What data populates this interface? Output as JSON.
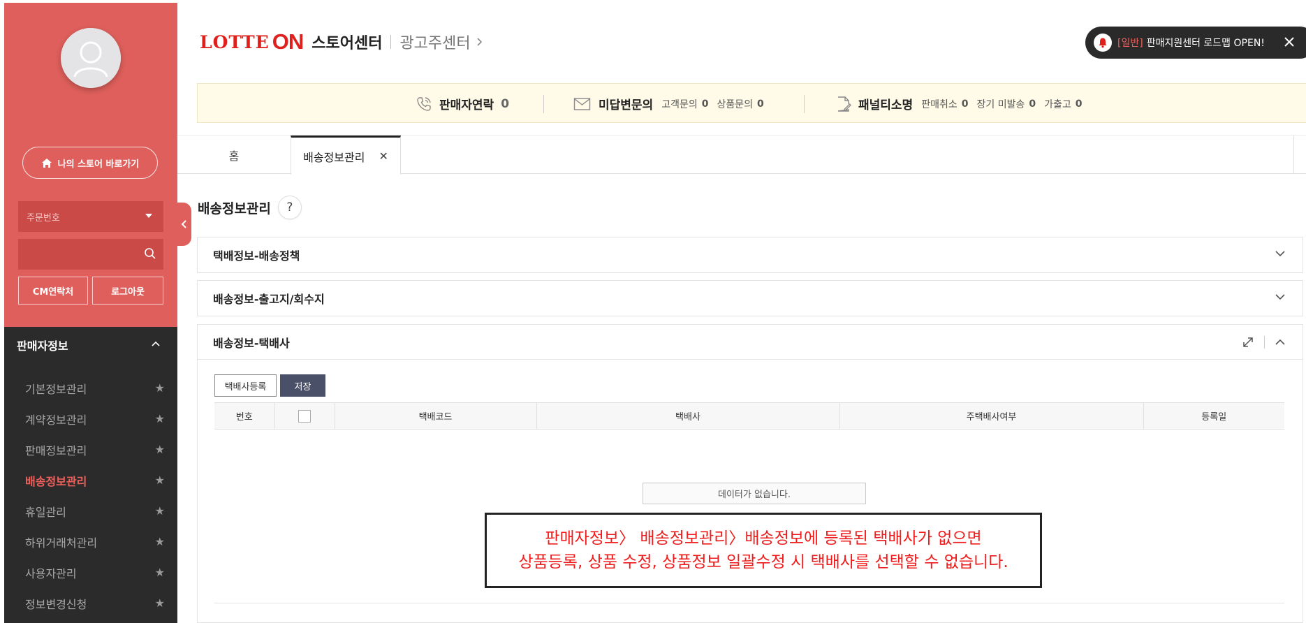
{
  "sidebar": {
    "store_link_label": "나의 스토어 바로가기",
    "select_value": "주문번호",
    "search_value": "",
    "cm_contact_label": "CM연락처",
    "logout_label": "로그아웃",
    "section_title": "판매자정보",
    "items": [
      {
        "label": "기본정보관리",
        "active": false
      },
      {
        "label": "계약정보관리",
        "active": false
      },
      {
        "label": "판매정보관리",
        "active": false
      },
      {
        "label": "배송정보관리",
        "active": true
      },
      {
        "label": "휴일관리",
        "active": false
      },
      {
        "label": "하위거래처관리",
        "active": false
      },
      {
        "label": "사용자관리",
        "active": false
      },
      {
        "label": "정보변경신청",
        "active": false
      }
    ]
  },
  "header": {
    "logo_lotte": "LOTTE",
    "logo_on": "ON",
    "store_center": "스토어센터",
    "ad_center": "광고주센터",
    "notice_tag": "[일반]",
    "notice_text": "판매지원센터 로드맵 OPEN!"
  },
  "info_bar": {
    "seller_contact_label": "판매자연락",
    "seller_contact_count": "0",
    "unanswered_label": "미답변문의",
    "customer_inquiry_label": "고객문의",
    "customer_inquiry_count": "0",
    "product_inquiry_label": "상품문의",
    "product_inquiry_count": "0",
    "penalty_label": "패널티소명",
    "sale_cancel_label": "판매취소",
    "sale_cancel_count": "0",
    "long_undelivered_label": "장기 미발송",
    "long_undelivered_count": "0",
    "fake_release_label": "가출고",
    "fake_release_count": "0"
  },
  "tabs": [
    {
      "label": "홈",
      "active": false
    },
    {
      "label": "배송정보관리",
      "active": true
    }
  ],
  "page": {
    "title": "배송정보관리",
    "help_label": "?",
    "sections": [
      {
        "title": "택배정보-배송정책",
        "expanded": false
      },
      {
        "title": "배송정보-출고지/회수지",
        "expanded": false
      },
      {
        "title": "배송정보-택배사",
        "expanded": true
      }
    ],
    "register_button": "택배사등록",
    "save_button": "저장",
    "columns": [
      "번호",
      "",
      "택배코드",
      "택배사",
      "주택배사여부",
      "등록일"
    ],
    "empty_message": "데이터가 없습니다."
  },
  "annotation": {
    "line1": "판매자정보〉 배송정보관리〉배송정보에 등록된 택배사가 없으면",
    "line2": "상품등록, 상품 수정, 상품정보 일괄수정 시 택배사를 선택할 수 없습니다."
  },
  "colors": {
    "brand_red": "#e0201c",
    "sidebar_top": "#de5f5b",
    "sidebar_dark": "#2b2b2b",
    "active_menu": "#f0605b",
    "save_button": "#4a5068",
    "annotation_text": "#ee1c1c"
  },
  "icons": [
    "user-avatar-icon",
    "home-icon",
    "caret-down-icon",
    "search-icon",
    "chevron-left-icon",
    "chevron-up-icon",
    "star-icon",
    "bell-icon",
    "close-icon",
    "phone-icon",
    "mail-icon",
    "document-edit-icon",
    "chevron-down-icon",
    "expand-icon",
    "chevron-right-icon"
  ]
}
